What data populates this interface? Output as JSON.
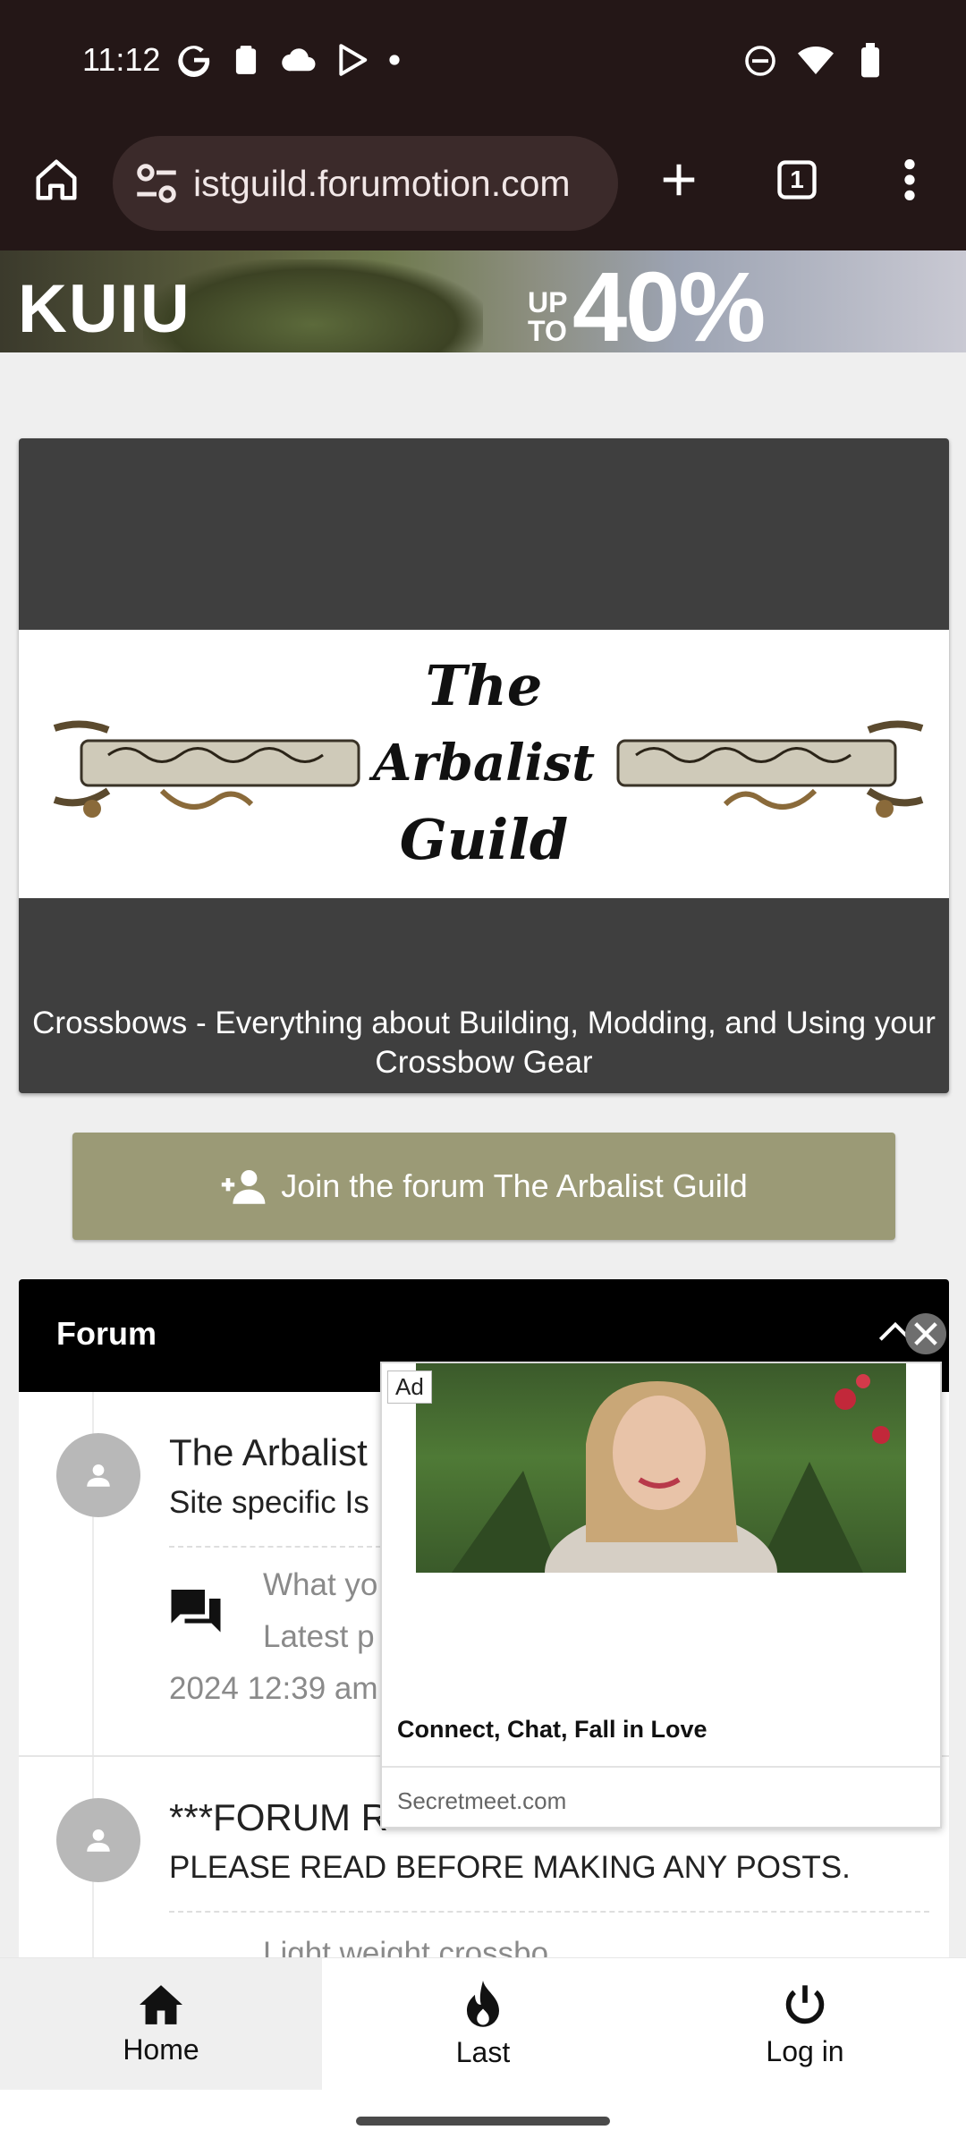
{
  "status_bar": {
    "time": "11:12"
  },
  "browser": {
    "url": "istguild.forumotion.com",
    "tab_count": "1"
  },
  "ad_banner": {
    "brand": "KUIU",
    "up_to": "UP\nTO",
    "offer": "40% OFF"
  },
  "header": {
    "logo_text": [
      "The",
      "Arbalist",
      "Guild"
    ],
    "tagline": "Crossbows - Everything about Building, Modding, and Using your Crossbow Gear"
  },
  "join_button": {
    "label": "Join the forum The Arbalist Guild"
  },
  "forum": {
    "title": "Forum",
    "rows": [
      {
        "title": "The Arbalist",
        "description": "Site specific Is",
        "last_topic": "What yo",
        "latest_label": "Latest p",
        "date": "2024 12:39 am"
      },
      {
        "title": "***FORUM R",
        "description": "PLEASE READ BEFORE MAKING ANY POSTS.",
        "last_topic": "Light weight crossbo"
      }
    ]
  },
  "popup_ad": {
    "tag": "Ad",
    "headline": "Connect, Chat, Fall in Love",
    "domain": "Secretmeet.com"
  },
  "bottom_nav": {
    "items": [
      {
        "label": "Home"
      },
      {
        "label": "Last"
      },
      {
        "label": "Log in"
      }
    ]
  }
}
